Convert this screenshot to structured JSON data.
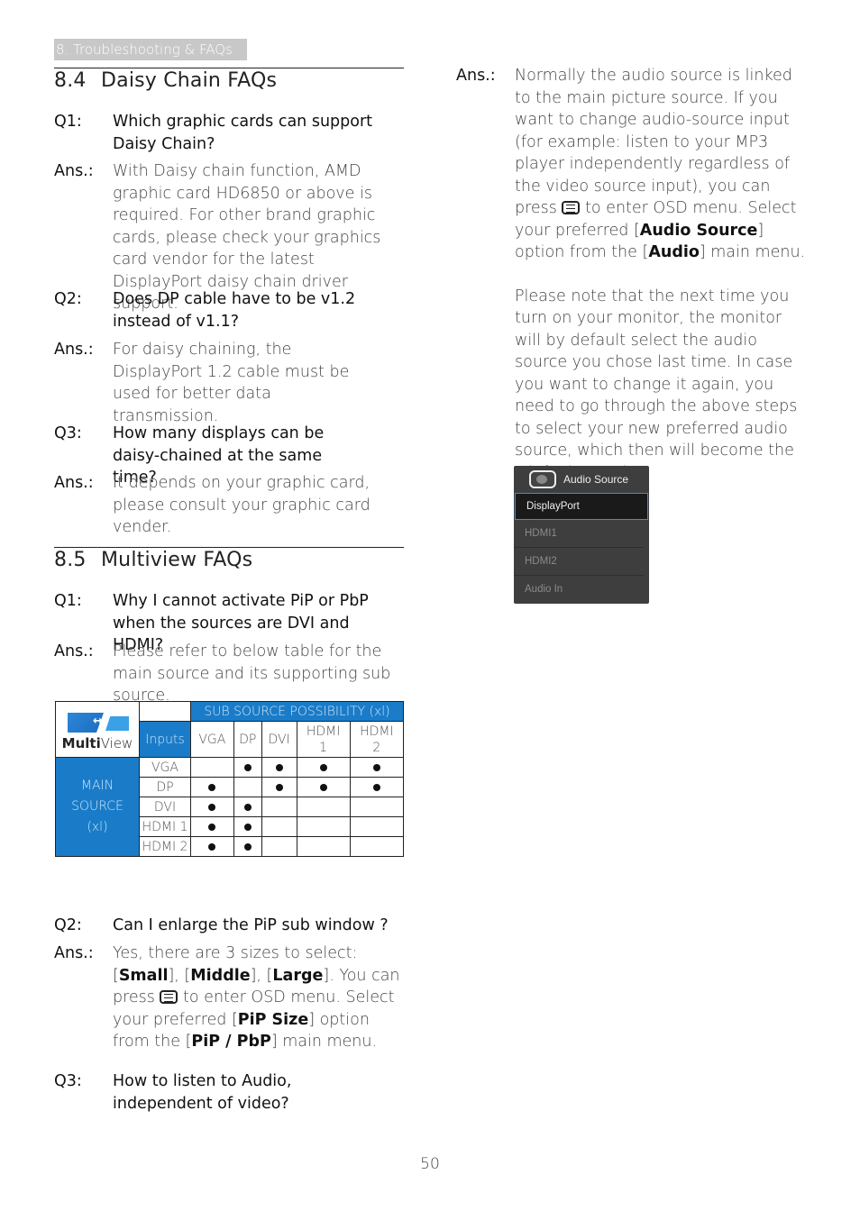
{
  "header": {
    "chapter": "8. Troubleshooting & FAQs"
  },
  "sections": [
    {
      "number": "8.4",
      "title": "Daisy Chain FAQs",
      "items": [
        {
          "q_label": "Q1:",
          "question": "Which graphic cards can support Daisy Chain?",
          "a_label": "Ans.:",
          "answer": "With Daisy chain function, AMD graphic card HD6850 or above is required. For other brand graphic cards, please check your graphics card vendor for the latest DisplayPort daisy chain driver support."
        },
        {
          "q_label": "Q2:",
          "question": "Does DP cable have to be v1.2 instead of v1.1?",
          "a_label": "Ans.:",
          "answer": "For daisy chaining, the DisplayPort 1.2 cable must be used for better data transmission."
        },
        {
          "q_label": "Q3:",
          "question": "How many displays can be daisy-chained at the same time?",
          "a_label": "Ans.:",
          "answer": "It depends on your graphic card, please consult your graphic card vender."
        }
      ]
    },
    {
      "number": "8.5",
      "title": "Multiview FAQs",
      "items": [
        {
          "q_label": "Q1:",
          "question": "Why I cannot activate PiP or PbP when the sources are DVI and HDMI?",
          "a_label": "Ans.:",
          "answer": "Please refer to below table for the main source and its supporting sub source."
        },
        {
          "q_label": "Q2:",
          "question": "Can I enlarge the PiP sub window ?",
          "a_label": "Ans.:",
          "answer_parts": {
            "p1": "Yes, there are 3 sizes to select: [",
            "b1": "Small",
            "p2": "], [",
            "b2": "Middle",
            "p3": "], [",
            "b3": "Large",
            "p4": "]. You can press ",
            "p5": " to enter OSD menu. Select your preferred [",
            "b4": "PiP Size",
            "p6": "] option from the [",
            "b5": "PiP / PbP",
            "p7": "] main menu."
          }
        },
        {
          "q_label": "Q3:",
          "question": "How to listen to Audio, independent of video?",
          "a_label": "Ans.:",
          "answer_parts": {
            "p1": "Normally the audio source is linked to the main picture source. If you want to change audio-source input (for example: listen to your MP3 player independently regardless of the video source input), you can press ",
            "p2": " to enter OSD menu. Select your preferred [",
            "b1": "Audio Source",
            "p3": "] option from the [",
            "b2": "Audio",
            "p4": "] main menu.",
            "note": "Please note that the next time you turn on your monitor, the monitor will by default select the audio source you chose last time. In case you want to change it again, you need to go through the above steps to select your new preferred audio source, which then will become the “default” mode."
          }
        }
      ]
    }
  ],
  "multiview_table": {
    "logo_text_bold": "Multi",
    "logo_text_light": "View",
    "sub_header": "SUB SOURCE POSSIBILITY (xl)",
    "inputs_label": "Inputs",
    "main_label": [
      "MAIN",
      "SOURCE",
      "(xl)"
    ],
    "columns": [
      "VGA",
      "DP",
      "DVI",
      "HDMI\n1",
      "HDMI\n2"
    ],
    "rows": [
      {
        "name": "VGA",
        "supported": [
          false,
          true,
          true,
          true,
          true
        ]
      },
      {
        "name": "DP",
        "supported": [
          true,
          false,
          true,
          true,
          true
        ]
      },
      {
        "name": "DVI",
        "supported": [
          true,
          true,
          false,
          false,
          false
        ]
      },
      {
        "name": "HDMI 1",
        "supported": [
          true,
          true,
          false,
          false,
          false
        ]
      },
      {
        "name": "HDMI 2",
        "supported": [
          true,
          true,
          false,
          false,
          false
        ]
      }
    ]
  },
  "osd_menu": {
    "title": "Audio Source",
    "icon": "audio-source-icon",
    "items": [
      "DisplayPort",
      "HDMI1",
      "HDMI2",
      "Audio In"
    ],
    "selected": "DisplayPort"
  },
  "footer": {
    "page_number": "50"
  },
  "icons": {
    "menu_button": "menu-button-icon"
  }
}
